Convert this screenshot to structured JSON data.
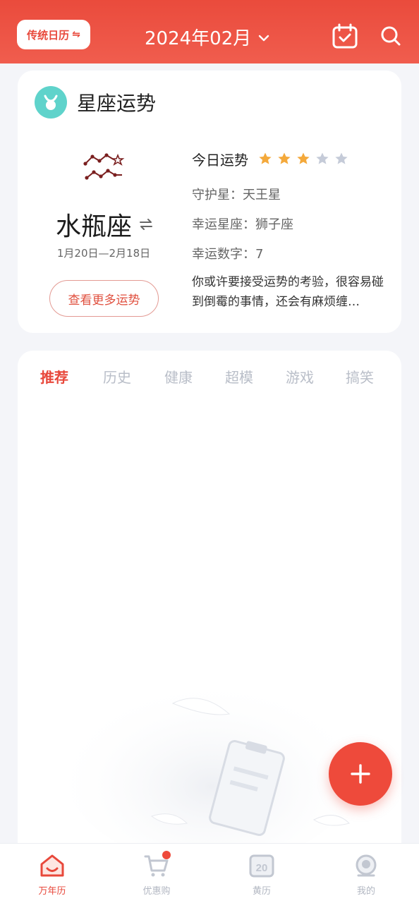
{
  "header": {
    "calendar_toggle_label": "传统日历",
    "calendar_toggle_icon": "⇋",
    "month_label": "2024年02月"
  },
  "horoscope": {
    "title": "星座运势",
    "sign_name": "水瓶座",
    "sign_dates": "1月20日—2月18日",
    "more_button": "查看更多运势",
    "today_label": "今日运势",
    "stars_filled": 3,
    "stars_total": 5,
    "guardian_star": "守护星：天王星",
    "lucky_sign": "幸运星座：狮子座",
    "lucky_number": "幸运数字：7",
    "description": "你或许要接受运势的考验，很容易碰到倒霉的事情，还会有麻烦缠…"
  },
  "feed": {
    "tabs": [
      "推荐",
      "历史",
      "健康",
      "超模",
      "游戏",
      "搞笑"
    ]
  },
  "bottom_nav": {
    "items": [
      {
        "label": "万年历",
        "icon": "home-icon"
      },
      {
        "label": "优惠购",
        "icon": "cart-icon"
      },
      {
        "label": "黄历",
        "icon": "almanac-icon",
        "badge_text": "20"
      },
      {
        "label": "我的",
        "icon": "profile-icon"
      }
    ]
  },
  "colors": {
    "brand_red": "#ea4b3c",
    "star_filled": "#f4a93b",
    "star_empty": "#c5cbd8",
    "taurus_badge": "#5fd3cb"
  }
}
